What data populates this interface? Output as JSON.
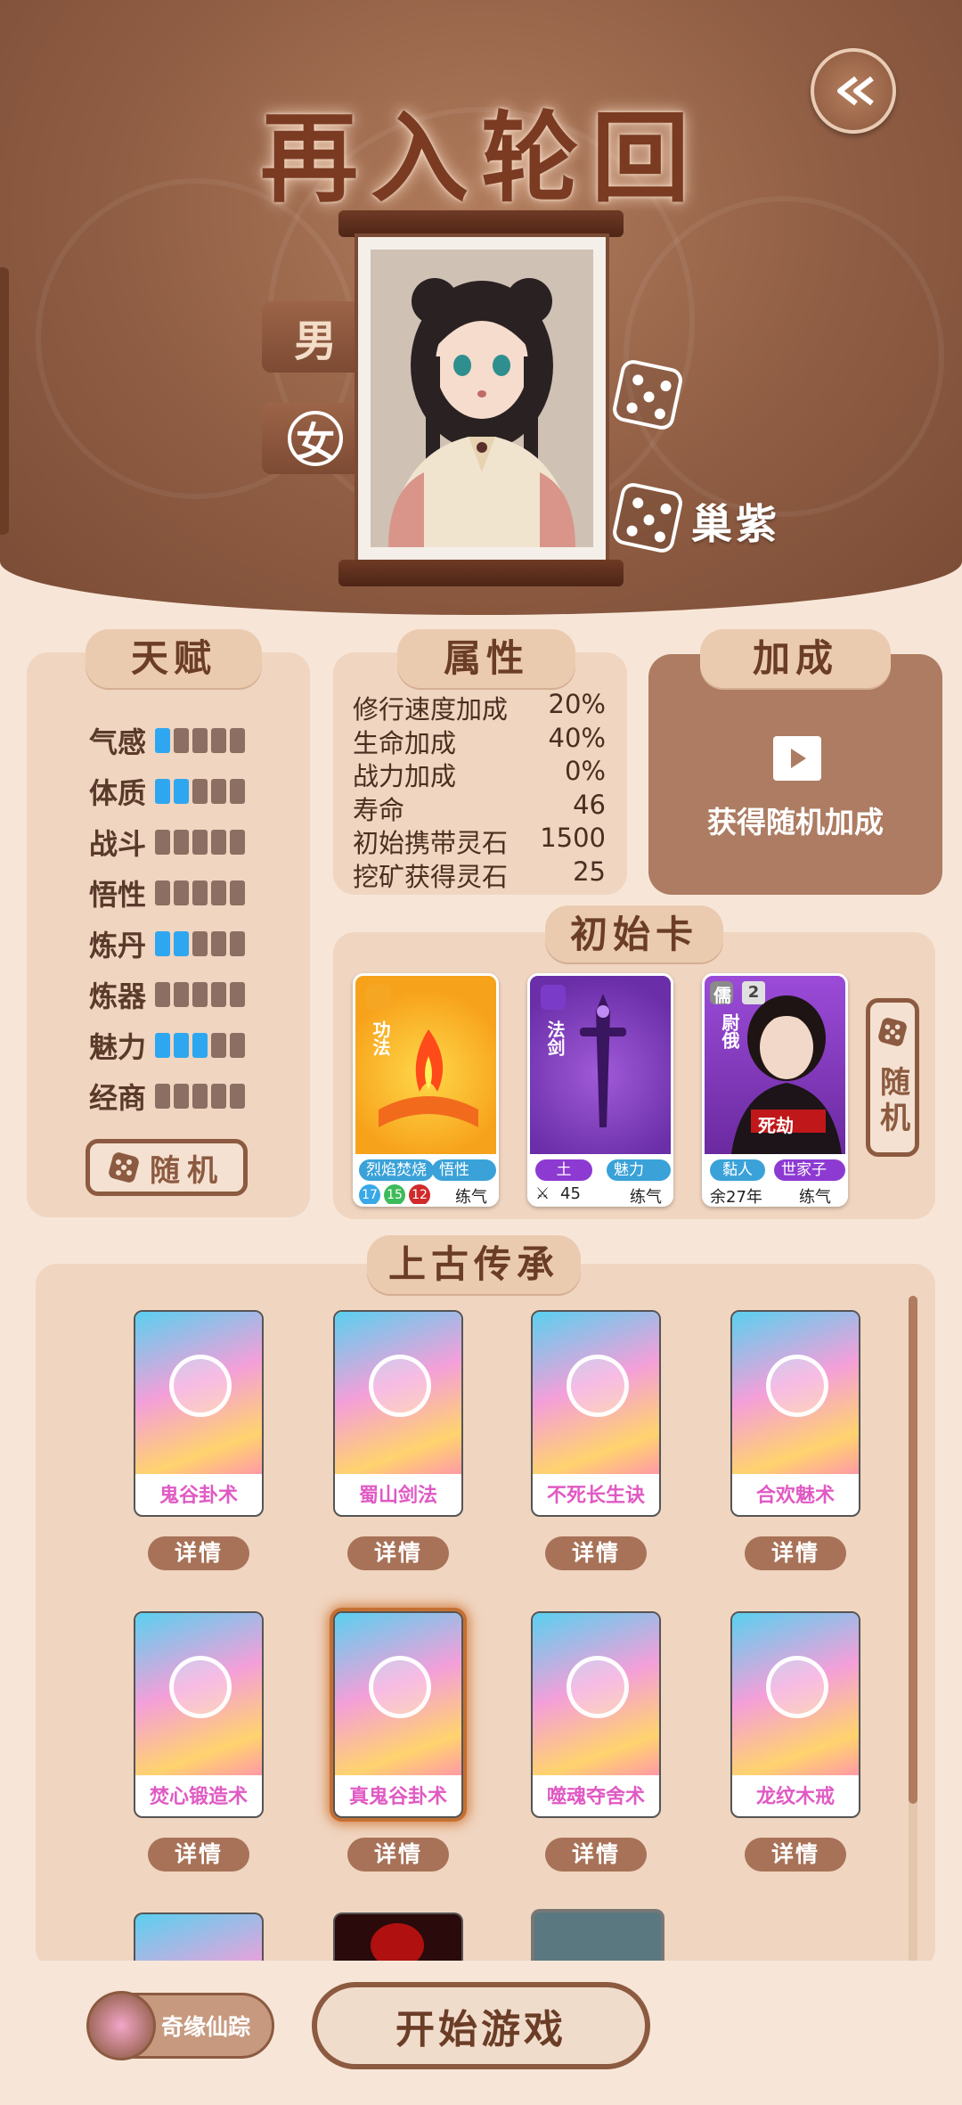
{
  "header": {
    "title": "再入轮回",
    "back_icon": "double-chevron-left-icon"
  },
  "gender": {
    "male": "男",
    "female": "女",
    "selected": "女"
  },
  "character": {
    "name": "巢紫"
  },
  "talent": {
    "title": "天赋",
    "items": [
      {
        "label": "气感",
        "level": 1
      },
      {
        "label": "体质",
        "level": 2
      },
      {
        "label": "战斗",
        "level": 0
      },
      {
        "label": "悟性",
        "level": 0
      },
      {
        "label": "炼丹",
        "level": 2
      },
      {
        "label": "炼器",
        "level": 0
      },
      {
        "label": "魅力",
        "level": 3
      },
      {
        "label": "经商",
        "level": 0
      }
    ],
    "max_level": 5,
    "random_label": "随机"
  },
  "attributes": {
    "title": "属性",
    "rows": [
      {
        "label": "修行速度加成",
        "value": "20%"
      },
      {
        "label": "生命加成",
        "value": "40%"
      },
      {
        "label": "战力加成",
        "value": "0%"
      },
      {
        "label": "寿命",
        "value": "46"
      },
      {
        "label": "初始携带灵石",
        "value": "1500"
      },
      {
        "label": "挖矿获得灵石",
        "value": "25"
      }
    ]
  },
  "bonus": {
    "title": "加成",
    "action": "获得随机加成"
  },
  "initial_cards": {
    "title": "初始卡",
    "random_label": "随机",
    "cards": [
      {
        "type_label": "功法",
        "tag1": "烈焰焚烧",
        "tag2": "悟性+1",
        "nums": [
          "17",
          "15",
          "12"
        ],
        "stage": "练气"
      },
      {
        "type_label": "法剑",
        "tag1": "土",
        "tag2": "魅力+1",
        "power": "45",
        "stage": "练气"
      },
      {
        "type_label": "尉俄",
        "badge": "儒",
        "level": "2",
        "banner": "死劫",
        "tag1": "黏人",
        "tag2": "世家子弟",
        "life": "余27年",
        "stage": "练气"
      }
    ]
  },
  "inheritance": {
    "title": "上古传承",
    "detail_label": "详情",
    "items": [
      {
        "name": "鬼谷卦术",
        "selected": false
      },
      {
        "name": "蜀山剑法",
        "selected": false
      },
      {
        "name": "不死长生诀",
        "selected": false
      },
      {
        "name": "合欢魅术",
        "selected": false
      },
      {
        "name": "焚心锻造术",
        "selected": false
      },
      {
        "name": "真鬼谷卦术",
        "selected": true
      },
      {
        "name": "噬魂夺舍术",
        "selected": false
      },
      {
        "name": "龙纹木戒",
        "selected": false
      }
    ]
  },
  "footer": {
    "mini_label": "奇缘仙踪",
    "start_label": "开始游戏"
  }
}
